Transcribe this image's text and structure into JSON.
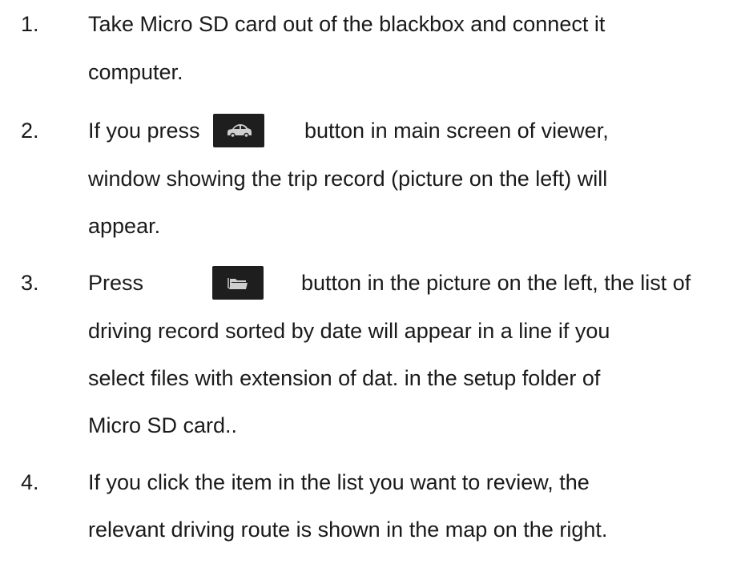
{
  "steps": [
    {
      "number": "1.",
      "lines": [
        "Take Micro SD card out of the blackbox and connect it",
        "computer."
      ]
    },
    {
      "number": "2.",
      "line1_before": "If you press",
      "line1_after": "button in main screen of viewer,",
      "icon": "car-icon",
      "lines": [
        "window showing the trip record (picture on the left) will",
        "appear."
      ]
    },
    {
      "number": "3.",
      "line1_before": "Press",
      "line1_after": "button in the picture on the left, the list of",
      "icon": "folder-icon",
      "lines": [
        "driving record sorted by date will appear in a line if you",
        "select files with extension of dat. in the setup folder of",
        "Micro SD card.."
      ]
    },
    {
      "number": "4.",
      "lines": [
        "If you click the item in the list you want to review, the",
        "relevant driving route is shown in the map on the right."
      ]
    }
  ],
  "colors": {
    "text": "#1a1a1a",
    "button_bg": "#1e1e1e",
    "icon": "#cfcfcf"
  }
}
